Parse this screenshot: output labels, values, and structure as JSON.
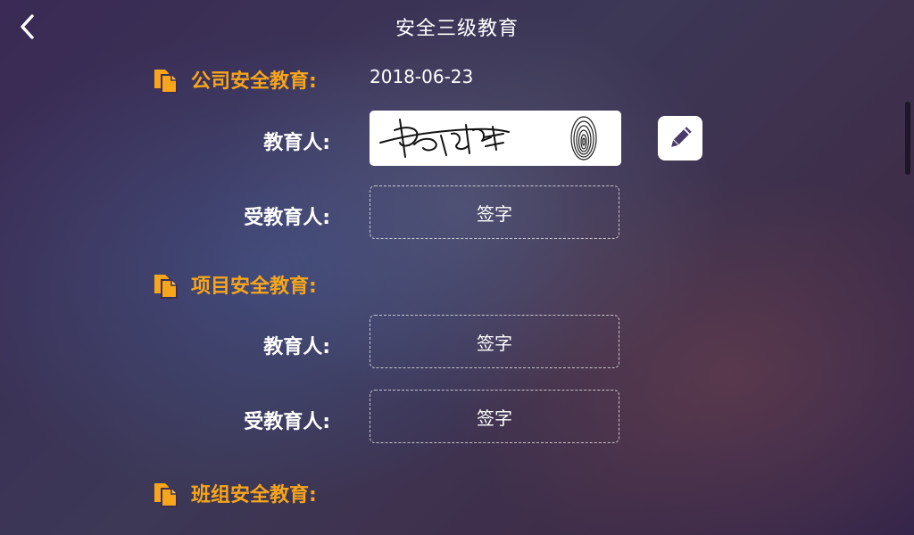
{
  "header": {
    "title": "安全三级教育",
    "back_icon": "chevron-left-icon"
  },
  "sections": [
    {
      "label": "公司安全教育:",
      "date": "2018-06-23",
      "educator_label": "教育人:",
      "educatee_label": "受教育人:",
      "educatee_button": "签字"
    },
    {
      "label": "项目安全教育:",
      "educator_label": "教育人:",
      "educator_button": "签字",
      "educatee_label": "受教育人:",
      "educatee_button": "签字"
    },
    {
      "label": "班组安全教育:"
    }
  ],
  "colors": {
    "accent": "#f7a51b",
    "text": "#ffffff"
  },
  "icons": {
    "section": "document-copy-icon",
    "edit": "pencil-icon"
  }
}
